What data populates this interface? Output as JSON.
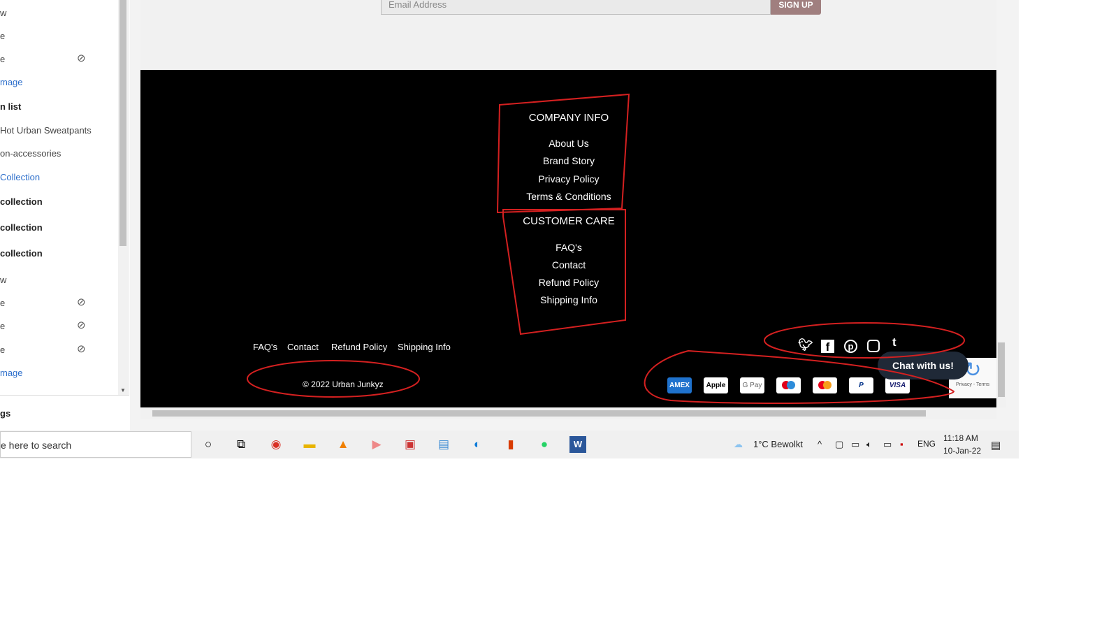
{
  "sidebar": {
    "items": [
      {
        "label": "w",
        "style": "g"
      },
      {
        "label": "e",
        "style": "g"
      },
      {
        "label": "e",
        "style": "g",
        "hidden": true
      },
      {
        "label": "mage",
        "style": "l"
      },
      {
        "label": "n list",
        "style": "b"
      },
      {
        "label": "Hot Urban Sweatpants",
        "style": "g"
      },
      {
        "label": "on-accessories",
        "style": "g"
      },
      {
        "label": "Collection",
        "style": "l"
      },
      {
        "label": " collection",
        "style": "b"
      },
      {
        "label": " collection",
        "style": "b"
      },
      {
        "label": " collection",
        "style": "b"
      },
      {
        "label": "w",
        "style": "g"
      },
      {
        "label": "e",
        "style": "g",
        "hidden": true
      },
      {
        "label": "e",
        "style": "g",
        "hidden": true
      },
      {
        "label": "e",
        "style": "g",
        "hidden": true
      },
      {
        "label": "mage",
        "style": "l"
      }
    ],
    "settings_label": "gs"
  },
  "newsletter": {
    "email_placeholder": "Email Address",
    "signup_label": "SIGN UP"
  },
  "footer": {
    "company_info": {
      "heading": "COMPANY INFO",
      "links": [
        "About Us",
        "Brand Story",
        "Privacy Policy",
        "Terms & Conditions"
      ]
    },
    "customer_care": {
      "heading": "CUSTOMER CARE",
      "links": [
        "FAQ's",
        "Contact",
        "Refund Policy",
        "Shipping Info"
      ]
    },
    "bottom_links": [
      "FAQ's",
      "Contact",
      "Refund Policy",
      "Shipping Info"
    ],
    "copyright": "© 2022 Urban Junkyz",
    "social": [
      "twitter",
      "facebook",
      "pinterest",
      "instagram",
      "tumblr"
    ],
    "payments": [
      "AMEX",
      "Apple Pay",
      "G Pay",
      "Maestro",
      "Mastercard",
      "PayPal",
      "VISA"
    ],
    "chat_label": "Chat with us!",
    "recaptcha": "Privacy - Terms"
  },
  "annotation_color": "#d42020",
  "taskbar": {
    "search_placeholder": "e here to search",
    "weather": "1°C  Bewolkt",
    "lang": "ENG",
    "time": "11:18 AM",
    "date": "10-Jan-22"
  }
}
